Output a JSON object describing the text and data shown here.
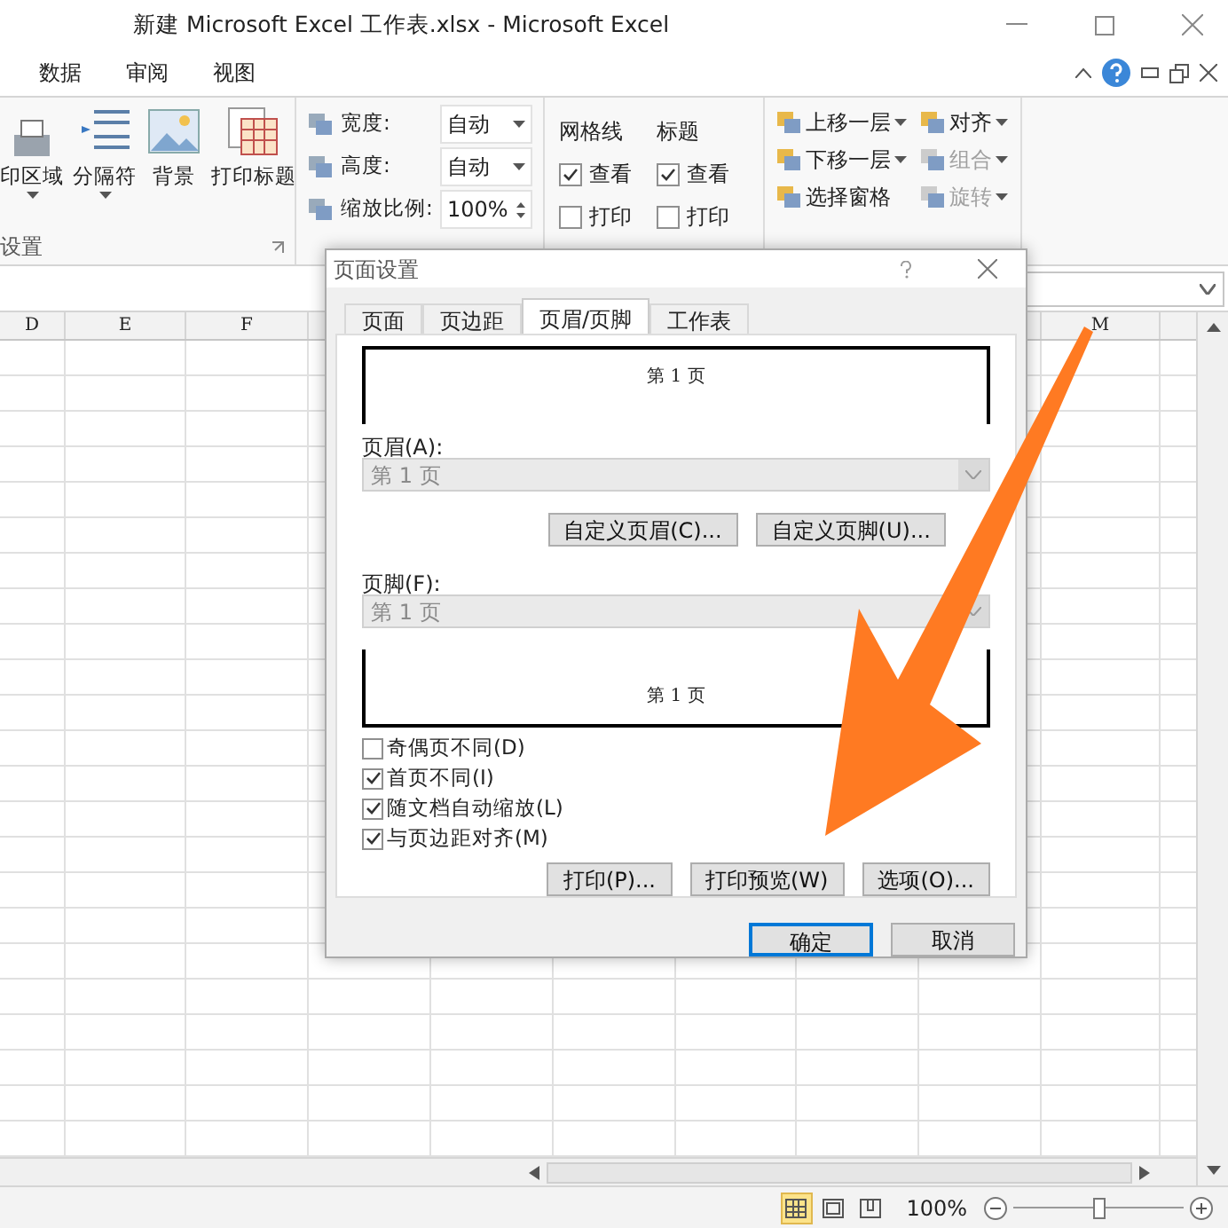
{
  "window": {
    "title": "新建 Microsoft Excel 工作表.xlsx - Microsoft Excel"
  },
  "ribbon_tabs": [
    "数据",
    "审阅",
    "视图"
  ],
  "ribbon": {
    "page_setup": {
      "label": "设置",
      "buttons": [
        {
          "label": "印区域",
          "dropdown": true
        },
        {
          "label": "分隔符",
          "dropdown": true
        },
        {
          "label": "背景",
          "dropdown": false
        },
        {
          "label": "打印标题",
          "dropdown": false
        }
      ]
    },
    "scale": [
      {
        "label": "宽度:",
        "value": "自动",
        "kind": "dropdown"
      },
      {
        "label": "高度:",
        "value": "自动",
        "kind": "dropdown"
      },
      {
        "label": "缩放比例:",
        "value": "100%",
        "kind": "spinner"
      }
    ],
    "sheet_options": [
      {
        "label": "网格线",
        "view": {
          "label": "查看",
          "checked": true
        },
        "print": {
          "label": "打印",
          "checked": false
        }
      },
      {
        "label": "标题",
        "view": {
          "label": "查看",
          "checked": true
        },
        "print": {
          "label": "打印",
          "checked": false
        }
      }
    ],
    "arrange": {
      "items": [
        {
          "label": "上移一层",
          "disabled": false
        },
        {
          "label": "对齐",
          "disabled": false
        },
        {
          "label": "下移一层",
          "disabled": false
        },
        {
          "label": "组合",
          "disabled": true
        },
        {
          "label": "选择窗格",
          "disabled": false
        },
        {
          "label": "旋转",
          "disabled": true
        }
      ]
    }
  },
  "columns": [
    "D",
    "E",
    "F",
    "M"
  ],
  "dialog": {
    "title": "页面设置",
    "tabs": [
      {
        "label": "页面",
        "selected": false
      },
      {
        "label": "页边距",
        "selected": false
      },
      {
        "label": "页眉/页脚",
        "selected": true
      },
      {
        "label": "工作表",
        "selected": false
      }
    ],
    "header_preview": "第 1 页",
    "header_label": "页眉(A):",
    "header_select": {
      "value": "第 1 页",
      "disabled": true
    },
    "custom_buttons": [
      "自定义页眉(C)...",
      "自定义页脚(U)..."
    ],
    "footer_label": "页脚(F):",
    "footer_select": {
      "value": "第 1 页",
      "disabled": true
    },
    "footer_preview": "第 1 页",
    "options": [
      {
        "label": "奇偶页不同(D)",
        "checked": false
      },
      {
        "label": "首页不同(I)",
        "checked": true
      },
      {
        "label": "随文档自动缩放(L)",
        "checked": true
      },
      {
        "label": "与页边距对齐(M)",
        "checked": true
      }
    ],
    "action_buttons": [
      "打印(P)...",
      "打印预览(W)",
      "选项(O)..."
    ],
    "ok": {
      "label": "确定",
      "default": true
    },
    "cancel": "取消"
  },
  "status_bar": {
    "views": [
      {
        "kind": "normal",
        "selected": true
      },
      {
        "kind": "layout",
        "selected": false
      },
      {
        "kind": "break",
        "selected": false
      }
    ],
    "zoom": "100%",
    "zoom_slider": {
      "level": 0.5
    }
  }
}
